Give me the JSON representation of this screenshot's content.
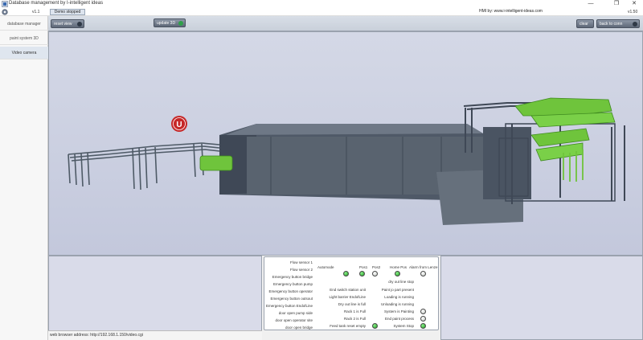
{
  "window": {
    "title": "Database management by I-intelligent ideas",
    "minimize": "—",
    "maximize": "❐",
    "close": "✕"
  },
  "toolbar": {
    "version_left": "v1.1",
    "demo_label": "Demo stopped",
    "hmi_text": "HMI by: www.i-intelligent-ideas.com",
    "version_right": "v1.50"
  },
  "sidebar": {
    "items": [
      {
        "label": "database manager"
      },
      {
        "label": "paint system 3D"
      },
      {
        "label": "Video camera"
      }
    ]
  },
  "main_toolbar": {
    "reset_view": "reset view",
    "update_3d": "update 3D",
    "clear": "clear",
    "back_to_conn": "back to conn"
  },
  "scene": {
    "marker_label": "U"
  },
  "address": {
    "text": "web browser address: http://192.168.1.150/video.cgi"
  },
  "status": {
    "left_labels": [
      "Flow sensor 1",
      "Flow sensor 2",
      "Emergency button bridge",
      "Emergency button pump",
      "Emergency button operator",
      "Emergency button outsout",
      "Emergency button EndofLine",
      "door open pump side",
      "door open operator site",
      "door open bridge"
    ],
    "top_headers": [
      "Automode",
      "Pos1",
      "Pos2",
      "Home Pos",
      "Alarm from Lenze"
    ],
    "top_leds": [
      "on",
      "on",
      "off",
      "on",
      "off"
    ],
    "mid_labels": [
      "End switch station unit",
      "Light barrier EndofLine",
      "Dry out line is full",
      "Rack 1 is Full",
      "Rack 2 is Full",
      "Feed tank reset empty"
    ],
    "right_labels": [
      "dry out line stop",
      "Paint jo part present",
      "Loading is running",
      "Unloading is running",
      "System is Painting",
      "End paint process",
      "System Stop"
    ],
    "right_leds": [
      "off",
      "off",
      "on"
    ],
    "feed_led": "on"
  },
  "colors": {
    "scene_bg": "#ccd0e0",
    "machine": "#5b6573",
    "conveyor": "#6fc43c",
    "marker": "#c62828"
  }
}
